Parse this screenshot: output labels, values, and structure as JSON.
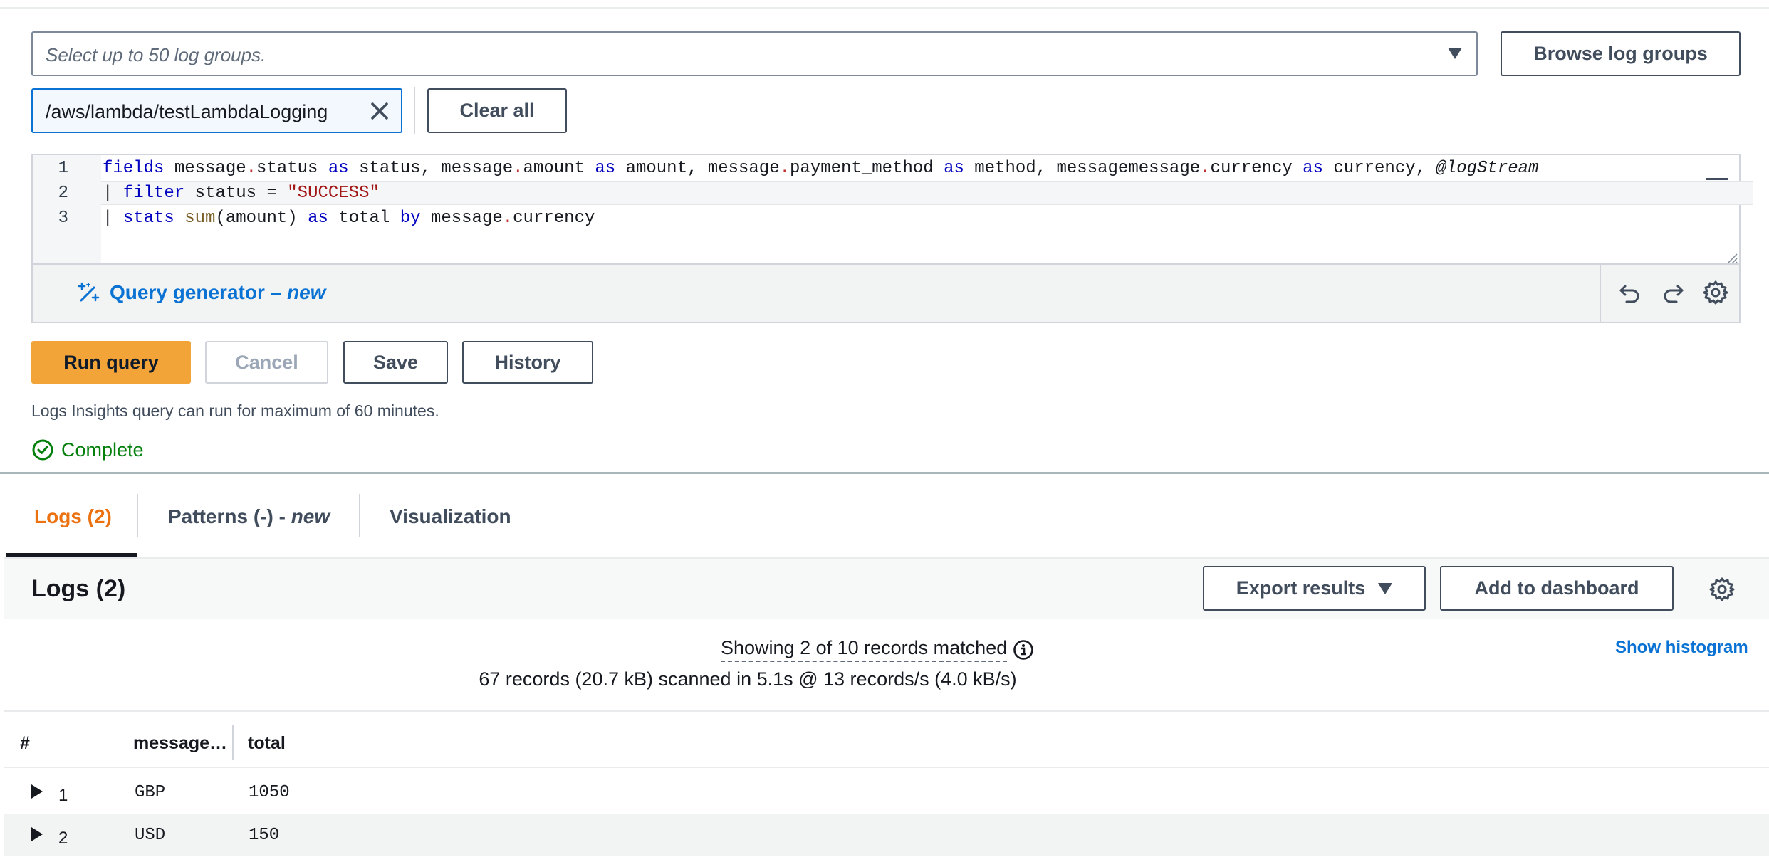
{
  "log_groups": {
    "placeholder": "Select up to 50 log groups.",
    "browse_label": "Browse log groups",
    "selected_token": "/aws/lambda/testLambdaLogging",
    "clear_all_label": "Clear all"
  },
  "editor": {
    "line_numbers": [
      "1",
      "2",
      "3"
    ],
    "query_generator_label": "Query generator",
    "query_generator_sep": " – ",
    "query_generator_new": "new"
  },
  "actions": {
    "run_label": "Run query",
    "cancel_label": "Cancel",
    "save_label": "Save",
    "history_label": "History"
  },
  "note": "Logs Insights query can run for maximum of 60 minutes.",
  "status": "Complete",
  "tabs": {
    "logs": "Logs (2)",
    "patterns": "Patterns (-) - ",
    "patterns_new": "new",
    "visualization": "Visualization"
  },
  "logs_panel": {
    "title": "Logs (2)",
    "export_label": "Export results",
    "dashboard_label": "Add to dashboard",
    "summary_matched": "Showing 2 of 10 records matched",
    "summary_scanned": "67 records (20.7 kB) scanned in 5.1s @ 13 records/s (4.0 kB/s)",
    "show_histogram": "Show histogram"
  },
  "table": {
    "headers": [
      "#",
      "message…",
      "total"
    ],
    "rows": [
      {
        "index": "1",
        "currency": "GBP",
        "total": "1050"
      },
      {
        "index": "2",
        "currency": "USD",
        "total": "150"
      }
    ]
  },
  "colors": {
    "primary": "#f3a438",
    "link": "#0972d3",
    "success": "#037f0c",
    "active_tab": "#ec7211"
  }
}
